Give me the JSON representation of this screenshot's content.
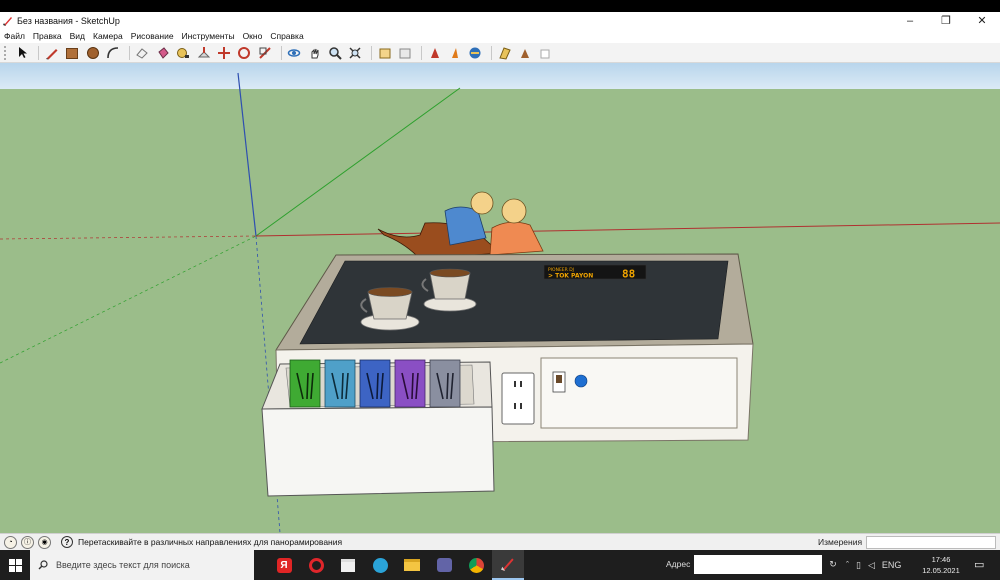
{
  "window": {
    "title": "Без названия - SketchUp",
    "controls": {
      "minimize": "–",
      "maximize": "❐",
      "close": "✕"
    }
  },
  "menu": [
    "Файл",
    "Правка",
    "Вид",
    "Камера",
    "Рисование",
    "Инструменты",
    "Окно",
    "Справка"
  ],
  "toolbar": {
    "tools": [
      "select-icon",
      "pencil-icon",
      "rectangle-icon",
      "circle-icon",
      "arc-icon",
      "eraser-icon",
      "paint-bucket-icon",
      "tape-measure-icon",
      "push-pull-icon",
      "move-icon",
      "rotate-icon",
      "scale-icon",
      "follow-me-icon",
      "offset-icon",
      "orbit-icon",
      "pan-icon",
      "zoom-icon",
      "zoom-extents-icon",
      "components-icon",
      "3d-warehouse-icon",
      "extension-warehouse-icon",
      "layout-icon",
      "sandbox-icon",
      "section-plane-icon",
      "text-icon",
      "dimension-icon",
      "axes-icon"
    ]
  },
  "scene": {
    "display_score": "88",
    "display_line1": "PIONEER DJ",
    "display_line2": "> TOK PAYON"
  },
  "status": {
    "hint": "Перетаскивайте в различных направлениях для панорамирования",
    "measure_label": "Измерения"
  },
  "taskbar": {
    "search_placeholder": "Введите здесь текст для поиска",
    "address_label": "Адрес",
    "lang": "ENG",
    "time": "17:46",
    "date": "12.05.2021"
  },
  "colors": {
    "sky": "#cfe3f4",
    "ground": "#9bbd8a",
    "table_top": "#2f3438",
    "table_frame": "#b3ac9b",
    "table_side": "#f4f2ec",
    "accent": "#f0a400"
  }
}
